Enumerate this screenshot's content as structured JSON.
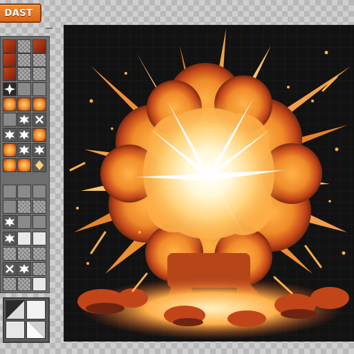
{
  "toolbar": {
    "button_label": "DAST"
  },
  "palette": {
    "panel_label": "tile-palette",
    "icons": [
      "sparkle-icon",
      "star-burst-icon",
      "cross-icon",
      "diamond-icon",
      "checker-icon"
    ]
  },
  "stage": {
    "content": "explosion-sprite"
  },
  "colors": {
    "brand_orange": "#e2741f",
    "stage_bg": "#121212",
    "explosion_core": "#fff7d6",
    "explosion_mid": "#f59a2a",
    "explosion_outer": "#c2451a",
    "smoke_dark": "#7a2a12"
  }
}
